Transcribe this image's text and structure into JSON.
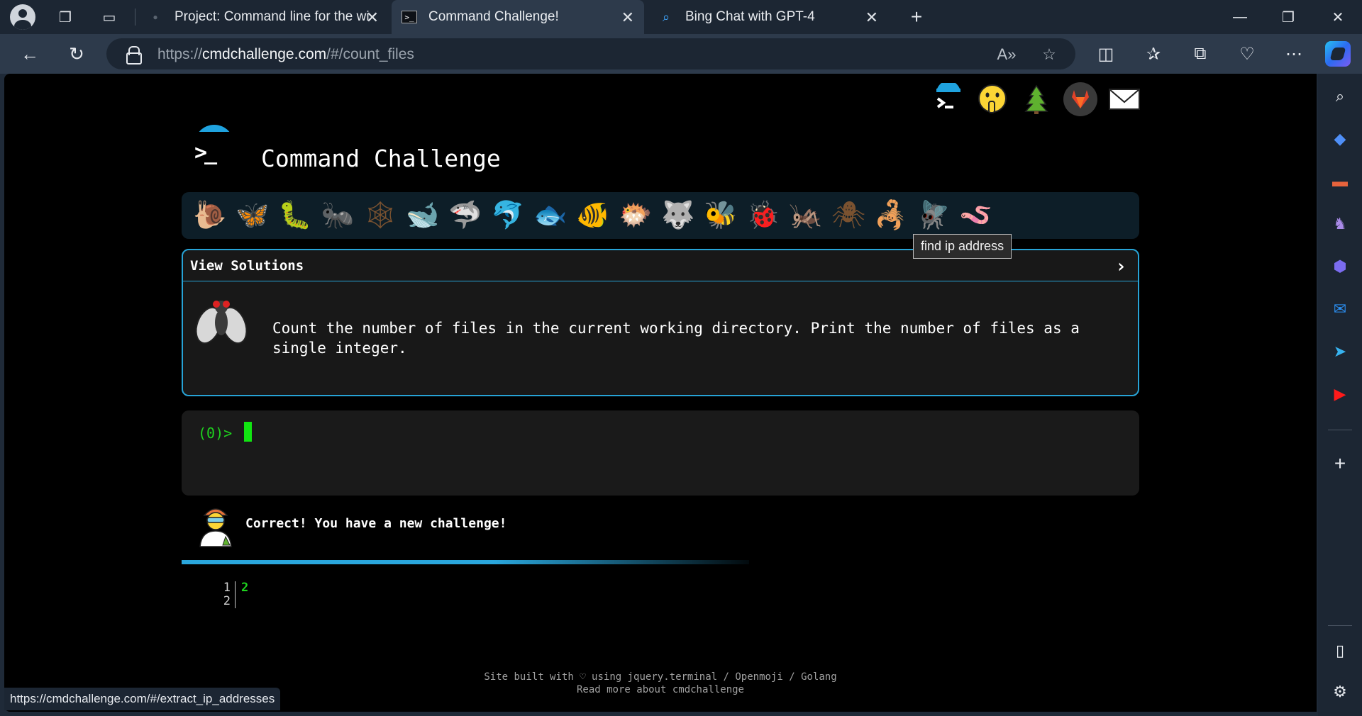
{
  "browser": {
    "tabs": [
      {
        "title": "Project: Command line for the wi",
        "favicon": "site-favicon"
      },
      {
        "title": "Command Challenge!",
        "favicon": "terminal-favicon"
      },
      {
        "title": "Bing Chat with GPT-4",
        "favicon": "search-favicon"
      }
    ],
    "active_tab": 1,
    "url_scheme": "https://",
    "url_host": "cmdchallenge.com",
    "url_path": "/#/count_files",
    "status_url": "https://cmdchallenge.com/#/extract_ip_addresses"
  },
  "page": {
    "title": "Command Challenge",
    "logo_prompt": ">_",
    "top_icons": [
      "terminal-logo-icon",
      "shushing-face-icon",
      "tree-icon",
      "gitlab-icon",
      "envelope-icon"
    ],
    "levels": [
      "snail",
      "butterfly",
      "caterpillar",
      "ant",
      "spider-web",
      "whale",
      "shark",
      "dolphin",
      "fish",
      "tropical-fish",
      "blowfish",
      "wolf",
      "bee",
      "ladybug",
      "cricket",
      "spider",
      "scorpion",
      "fly",
      "worm"
    ],
    "level_glyphs": [
      "🐌",
      "🦋",
      "🐛",
      "🐜",
      "🕸",
      "🐋",
      "🦈",
      "🐬",
      "🐟",
      "🐠",
      "🐡",
      "🐺",
      "🐝",
      "🐞",
      "🦗",
      "🕷",
      "🦂",
      "🪰",
      "🪱"
    ],
    "tooltip": "find ip address",
    "challenge": {
      "header": "View Solutions",
      "chevron": "›",
      "description": "Count the number of files in the current working directory. Print the number of files as a single integer."
    },
    "terminal": {
      "prompt": "(0)>"
    },
    "status_message": "Correct! You have a new challenge!",
    "progress": 0.55,
    "output": {
      "line_numbers": "1\n2",
      "code": "2"
    },
    "footer": {
      "line1": "Site built with ♡ using jquery.terminal / Openmoji / Golang",
      "line2": "Read more about cmdchallenge"
    }
  }
}
